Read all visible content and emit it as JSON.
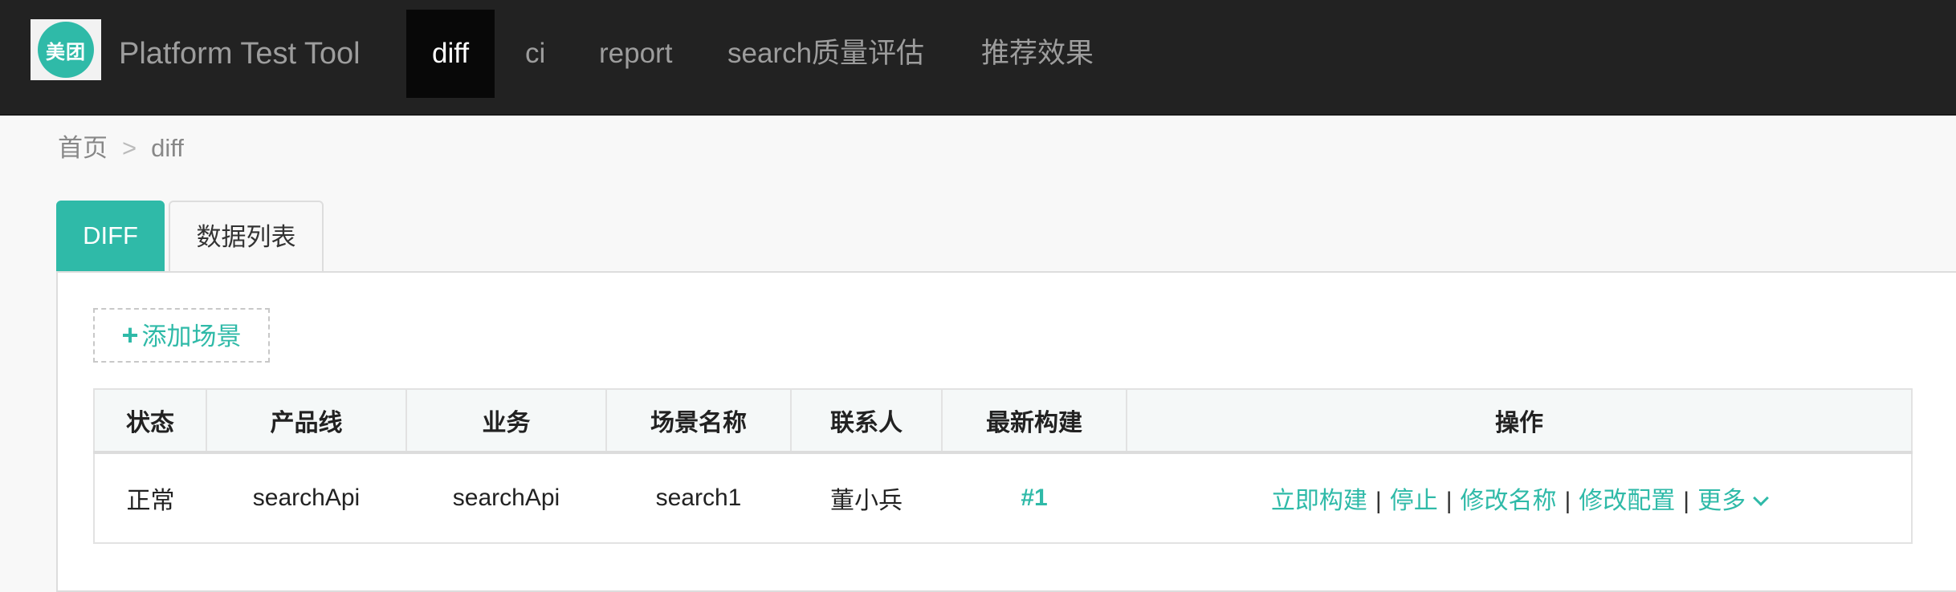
{
  "navbar": {
    "logo_text": "美团",
    "brand": "Platform Test Tool",
    "items": [
      {
        "label": "diff",
        "active": true
      },
      {
        "label": "ci",
        "active": false
      },
      {
        "label": "report",
        "active": false
      },
      {
        "label": "search质量评估",
        "active": false
      },
      {
        "label": "推荐效果",
        "active": false
      }
    ]
  },
  "breadcrumb": {
    "home": "首页",
    "separator": ">",
    "current": "diff"
  },
  "tabs": [
    {
      "label": "DIFF",
      "active": true
    },
    {
      "label": "数据列表",
      "active": false
    }
  ],
  "toolbar": {
    "add_scene_icon": "plus-icon",
    "add_scene_label": "添加场景"
  },
  "table": {
    "headers": [
      "状态",
      "产品线",
      "业务",
      "场景名称",
      "联系人",
      "最新构建",
      "操作"
    ],
    "rows": [
      {
        "status": "正常",
        "product_line": "searchApi",
        "business": "searchApi",
        "scene_name": "search1",
        "contact": "董小兵",
        "latest_build": "#1",
        "actions": {
          "build_now": "立即构建",
          "stop": "停止",
          "rename": "修改名称",
          "edit_config": "修改配置",
          "more": "更多",
          "separator": "|"
        }
      }
    ]
  },
  "colors": {
    "accent": "#2fbaa8",
    "navbar_bg": "#222222",
    "active_nav_bg": "#080808",
    "status_normal": "#1a34c9"
  }
}
